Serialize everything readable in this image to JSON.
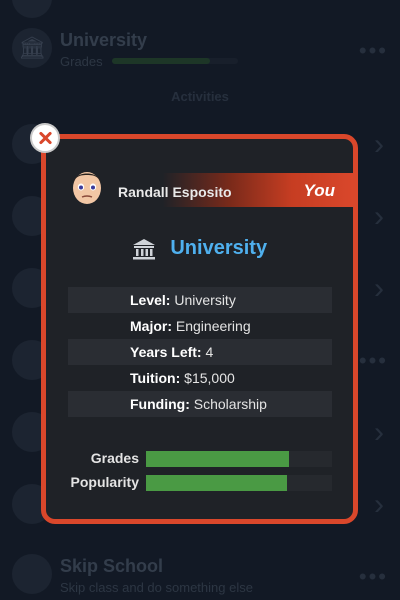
{
  "background": {
    "top_item": {
      "title": "University",
      "subtitle": "Grades",
      "progress": 0.78
    },
    "section_label": "Activities",
    "skip_item": {
      "title": "Skip School",
      "subtitle": "Skip class and do something else"
    }
  },
  "modal": {
    "person_name": "Randall Esposito",
    "relation": "You",
    "title": "University",
    "title_icon": "university-icon",
    "details": [
      {
        "label": "Level:",
        "value": "University"
      },
      {
        "label": "Major:",
        "value": "Engineering"
      },
      {
        "label": "Years Left:",
        "value": "4"
      },
      {
        "label": "Tuition:",
        "value": "$15,000"
      },
      {
        "label": "Funding:",
        "value": "Scholarship"
      }
    ],
    "stats": [
      {
        "label": "Grades",
        "value": 0.77
      },
      {
        "label": "Popularity",
        "value": 0.76
      }
    ],
    "colors": {
      "accent": "#d9472b",
      "title": "#4fb0ee",
      "bar": "#4a9a44"
    }
  }
}
